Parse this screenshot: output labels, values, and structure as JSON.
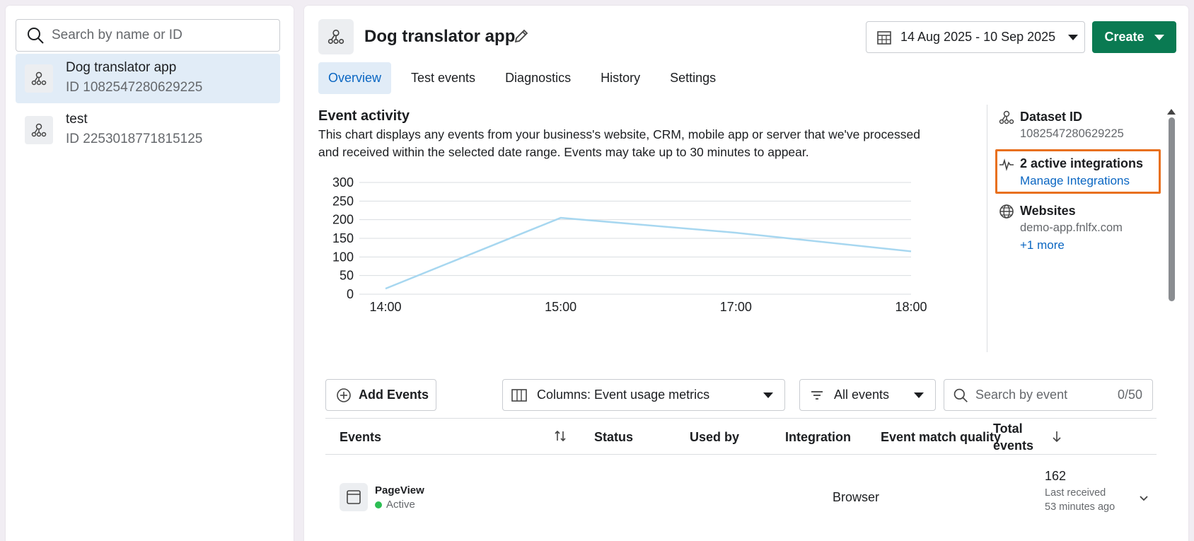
{
  "sidebar": {
    "search_placeholder": "Search by name or ID",
    "datasets": [
      {
        "name": "Dog translator app",
        "id": "ID 1082547280629225",
        "selected": true
      },
      {
        "name": "test",
        "id": "ID 2253018771815125",
        "selected": false
      }
    ]
  },
  "header": {
    "title": "Dog translator app",
    "date_range": "14 Aug 2025 - 10 Sep 2025",
    "create_label": "Create"
  },
  "tabs": [
    "Overview",
    "Test events",
    "Diagnostics",
    "History",
    "Settings"
  ],
  "activity": {
    "title": "Event activity",
    "description": "This chart displays any events from your business's website, CRM, mobile app or server that we've processed and received within the selected date range. Events may take up to 30 minutes to appear."
  },
  "chart_data": {
    "type": "line",
    "x": [
      "14:00",
      "15:00",
      "17:00",
      "18:00"
    ],
    "series": [
      {
        "values": [
          15,
          205,
          165,
          115
        ],
        "color": "#a7d7f0"
      }
    ],
    "yticks": [
      "300",
      "250",
      "200",
      "150",
      "100",
      "50",
      "0"
    ],
    "ylim": [
      0,
      300
    ],
    "grid": true
  },
  "side_info": {
    "dataset_label": "Dataset ID",
    "dataset_id": "1082547280629225",
    "integrations_title": "2 active integrations",
    "integrations_link": "Manage Integrations",
    "websites_title": "Websites",
    "website": "demo-app.fnlfx.com",
    "more_link": "+1 more"
  },
  "toolbar": {
    "add_events": "Add Events",
    "columns": "Columns: Event usage metrics",
    "filter": "All events",
    "search_placeholder": "Search by event",
    "search_count": "0/50"
  },
  "table": {
    "headers": {
      "events": "Events",
      "status": "Status",
      "used_by": "Used by",
      "integration": "Integration",
      "emq": "Event match quality",
      "total": "Total events"
    },
    "rows": [
      {
        "event": "PageView",
        "status": "Active",
        "integration": "Browser",
        "total": "162",
        "last_received": "Last received 53 minutes ago"
      }
    ]
  },
  "colors": {
    "accent": "#0a66c2",
    "create": "#0a7a52",
    "highlight": "#e8701e",
    "active_dot": "#2dbe54"
  }
}
